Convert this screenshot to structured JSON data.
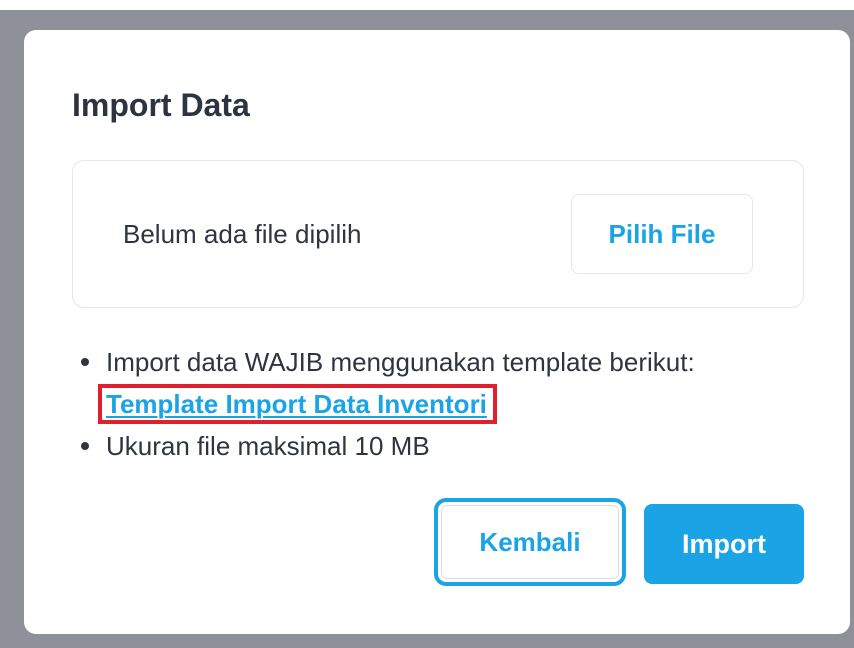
{
  "modal": {
    "title": "Import Data",
    "file_status": "Belum ada file dipilih",
    "pick_file_label": "Pilih File",
    "notes": [
      "Import data WAJIB menggunakan template berikut:",
      "Ukuran file maksimal 10 MB"
    ],
    "template_link_label": "Template Import Data Inventori",
    "back_label": "Kembali",
    "import_label": "Import"
  },
  "colors": {
    "accent": "#1aa3e5",
    "highlight_box": "#e0202e",
    "overlay": "#8e9199",
    "text": "#2f3440"
  }
}
